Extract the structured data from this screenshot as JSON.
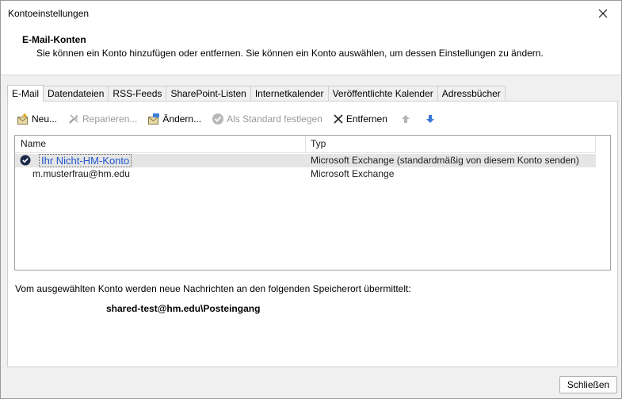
{
  "window": {
    "title": "Kontoeinstellungen"
  },
  "header": {
    "title": "E-Mail-Konten",
    "description": "Sie können ein Konto hinzufügen oder entfernen. Sie können ein Konto auswählen, um dessen Einstellungen zu ändern."
  },
  "tabs": [
    {
      "label": "E-Mail",
      "active": true
    },
    {
      "label": "Datendateien"
    },
    {
      "label": "RSS-Feeds"
    },
    {
      "label": "SharePoint-Listen"
    },
    {
      "label": "Internetkalender"
    },
    {
      "label": "Veröffentlichte Kalender"
    },
    {
      "label": "Adressbücher"
    }
  ],
  "toolbar": {
    "new_label": "Neu...",
    "repair_label": "Reparieren...",
    "change_label": "Ändern...",
    "set_default_label": "Als Standard festlegen",
    "remove_label": "Entfernen",
    "up_icon": "arrow-up-icon",
    "down_icon": "arrow-down-icon"
  },
  "list": {
    "columns": {
      "name": "Name",
      "type": "Typ"
    },
    "rows": [
      {
        "name": "Ihr Nicht-HM-Konto",
        "type": "Microsoft Exchange (standardmäßig von diesem Konto senden)",
        "selected": true,
        "default": true
      },
      {
        "name": "m.musterfrau@hm.edu",
        "type": "Microsoft Exchange",
        "selected": false,
        "default": false
      }
    ]
  },
  "info": {
    "text": "Vom ausgewählten Konto werden neue Nachrichten an den folgenden Speicherort übermittelt:",
    "location": "shared-test@hm.edu\\Posteingang"
  },
  "footer": {
    "close_label": "Schließen"
  },
  "colors": {
    "accent_blue": "#1f55cc",
    "selection_gray": "#e5e5e5",
    "arrow_down_blue": "#3a78d8"
  }
}
